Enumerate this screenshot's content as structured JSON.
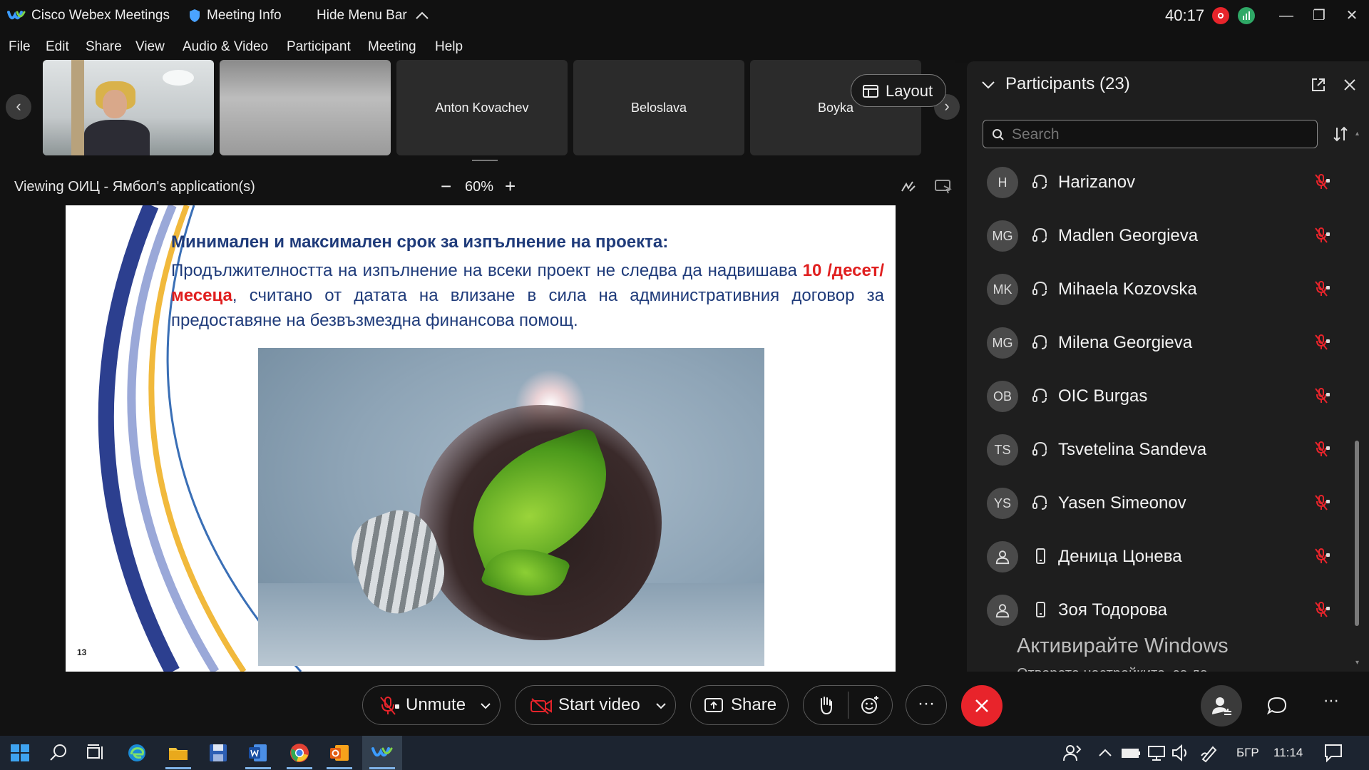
{
  "titlebar": {
    "app_name": "Cisco Webex Meetings",
    "meeting_info": "Meeting Info",
    "hide_menu": "Hide Menu Bar",
    "timer": "40:17"
  },
  "menu": [
    "File",
    "Edit",
    "Share",
    "View",
    "Audio & Video",
    "Participant",
    "Meeting",
    "Help"
  ],
  "thumbnails": [
    {
      "name": ""
    },
    {
      "name": ""
    },
    {
      "name": "Anton Kovachev"
    },
    {
      "name": "Beloslava"
    },
    {
      "name": "Boyka"
    }
  ],
  "layout_label": "Layout",
  "viewing": {
    "text": "Viewing ОИЦ - Ямбол's application(s)",
    "zoom": "60%",
    "minus": "−",
    "plus": "+"
  },
  "slide": {
    "title": "Минимален и максимален срок за изпълнение на проекта:",
    "body_1": "Продължителността на изпълнение на всеки проект не следва да надвишава ",
    "body_red": "10 /десет/ месеца",
    "body_2": ", считано от датата на влизане в сила на административния договор за предоставяне на безвъзмездна финансова помощ.",
    "page_number": "13"
  },
  "participants": {
    "title": "Participants (23)",
    "search_placeholder": "Search",
    "list": [
      {
        "initials": "H",
        "name": "Harizanov",
        "device": "headset"
      },
      {
        "initials": "MG",
        "name": "Madlen Georgieva",
        "device": "headset"
      },
      {
        "initials": "MK",
        "name": "Mihaela Kozovska",
        "device": "headset"
      },
      {
        "initials": "MG",
        "name": "Milena Georgieva",
        "device": "headset"
      },
      {
        "initials": "OB",
        "name": "OIC Burgas",
        "device": "headset"
      },
      {
        "initials": "TS",
        "name": "Tsvetelina Sandeva",
        "device": "headset"
      },
      {
        "initials": "YS",
        "name": "Yasen Simeonov",
        "device": "headset"
      },
      {
        "initials": "",
        "name": "Деница Цонева",
        "device": "phone"
      },
      {
        "initials": "",
        "name": "Зоя Тодорова",
        "device": "phone"
      }
    ]
  },
  "watermark": {
    "line1": "Активирайте Windows",
    "line2": "Отворете настройките, за да активирате Windows."
  },
  "toolbar": {
    "unmute": "Unmute",
    "start_video": "Start video",
    "share": "Share",
    "more": "···"
  },
  "taskbar": {
    "language": "БГР",
    "time": "11:14"
  },
  "colors": {
    "end_call": "#e8242b",
    "slide_blue": "#1f3b7a",
    "slide_red": "#e01f1f"
  }
}
